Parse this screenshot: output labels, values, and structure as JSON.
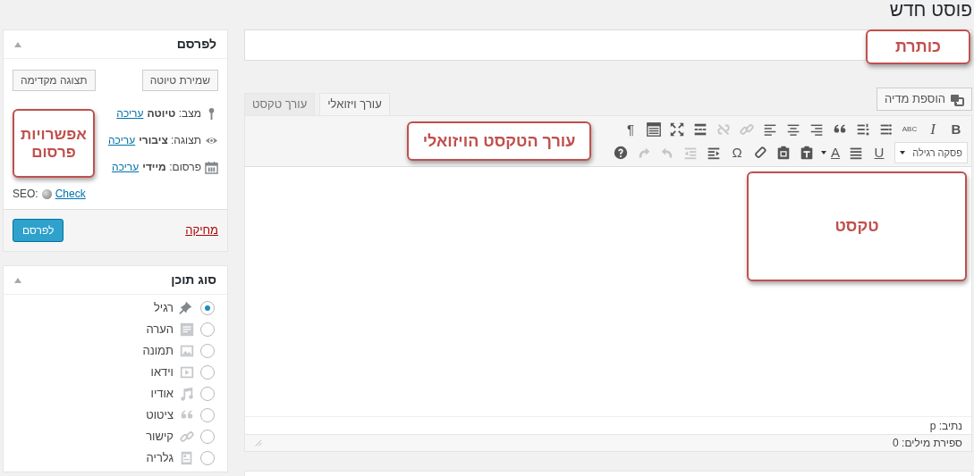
{
  "page_title": "פוסט חדש",
  "title_field": {
    "annotation": "כותרת"
  },
  "media_button": "הוספת מדיה",
  "tabs": [
    {
      "label": "עורך ויזואלי",
      "selected": true
    },
    {
      "label": "עורך טקסט",
      "selected": false
    }
  ],
  "toolbar": {
    "annotation": "עורך הטקסט הויזואלי",
    "row_1": [
      {
        "kind": "bold",
        "text": "B",
        "disabled": false
      },
      {
        "kind": "italic",
        "text": "I",
        "disabled": false
      },
      {
        "kind": "strike",
        "text": "ABC",
        "disabled": false
      },
      {
        "kind": "bullets",
        "disabled": false
      },
      {
        "kind": "numbers",
        "disabled": false
      },
      {
        "kind": "quote",
        "disabled": false
      },
      {
        "kind": "alignright",
        "disabled": false
      },
      {
        "kind": "aligncenter",
        "disabled": false
      },
      {
        "kind": "alignleft",
        "disabled": false
      },
      {
        "kind": "link",
        "disabled": true
      },
      {
        "kind": "unlink",
        "disabled": true
      },
      {
        "kind": "more",
        "disabled": false
      },
      {
        "kind": "fullscreen",
        "disabled": false
      },
      {
        "kind": "kitchensink",
        "disabled": false
      },
      {
        "kind": "ltr",
        "text": "¶",
        "disabled": false
      }
    ],
    "format_select": "פסקה רגילה",
    "row_2": [
      {
        "kind": "underline",
        "text": "U",
        "disabled": false
      },
      {
        "kind": "justify",
        "disabled": false
      },
      {
        "kind": "color",
        "text": "A",
        "disabled": false
      },
      {
        "kind": "pastetext",
        "disabled": false
      },
      {
        "kind": "pasteword",
        "disabled": false
      },
      {
        "kind": "eraser",
        "disabled": false
      },
      {
        "kind": "glyph",
        "text": "Ω",
        "disabled": false
      },
      {
        "kind": "outdent",
        "disabled": false
      },
      {
        "kind": "indent",
        "disabled": true
      },
      {
        "kind": "undo",
        "disabled": true
      },
      {
        "kind": "redo",
        "disabled": true
      },
      {
        "kind": "help",
        "disabled": false
      }
    ]
  },
  "editor": {
    "annotation": "טקסט",
    "path": "נתיב: p",
    "word_count": "ספירת מילים: 0"
  },
  "publish": {
    "title": "לפרסם",
    "annotation": "אפשרויות פרסום",
    "save_draft": "שמירת טיוטה",
    "preview": "תצוגה מקדימה",
    "rows": [
      {
        "kind": "status",
        "label": "מצב:",
        "value": "טיוטה",
        "link": "עריכה"
      },
      {
        "kind": "visibility",
        "label": "תצוגה:",
        "value": "ציבורי",
        "link": "עריכה"
      },
      {
        "kind": "schedule",
        "label": "פרסום:",
        "value": "מיידי",
        "link": "עריכה"
      }
    ],
    "seo_label": "SEO:",
    "seo_link": "Check",
    "delete": "מחיקה",
    "publish_button": "לפרסם"
  },
  "format": {
    "title": "סוג תוכן",
    "items": [
      {
        "kind": "standard",
        "label": "רגיל",
        "selected": true
      },
      {
        "kind": "aside",
        "label": "הערה",
        "selected": false
      },
      {
        "kind": "image",
        "label": "תמונה",
        "selected": false
      },
      {
        "kind": "video",
        "label": "וידאו",
        "selected": false
      },
      {
        "kind": "audio",
        "label": "אודיו",
        "selected": false
      },
      {
        "kind": "quote",
        "label": "ציטוט",
        "selected": false
      },
      {
        "kind": "link",
        "label": "קישור",
        "selected": false
      },
      {
        "kind": "gallery",
        "label": "גלריה",
        "selected": false
      }
    ]
  }
}
